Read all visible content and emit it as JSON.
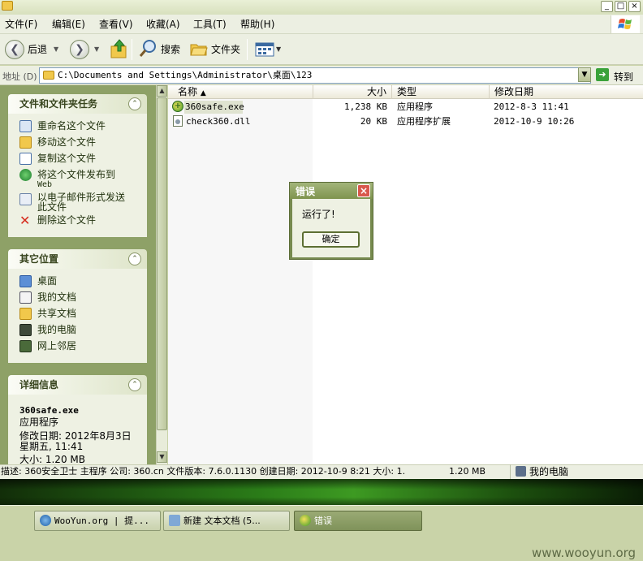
{
  "window": {
    "menu": [
      "文件(F)",
      "编辑(E)",
      "查看(V)",
      "收藏(A)",
      "工具(T)",
      "帮助(H)"
    ],
    "caption_buttons": [
      "_",
      "□",
      "×"
    ]
  },
  "toolbar": {
    "back_label": "后退",
    "search_label": "搜索",
    "folders_label": "文件夹"
  },
  "address": {
    "label": "地址 (D)",
    "value": "C:\\Documents and Settings\\Administrator\\桌面\\123",
    "go_label": "转到"
  },
  "tasks": {
    "file_tasks": {
      "title": "文件和文件夹任务",
      "items": [
        {
          "label": "重命名这个文件",
          "icon": "rename-icon"
        },
        {
          "label": "移动这个文件",
          "icon": "move-icon"
        },
        {
          "label": "复制这个文件",
          "icon": "copy-icon"
        },
        {
          "label": "将这个文件发布到",
          "label2": "Web",
          "icon": "publish-web-icon"
        },
        {
          "label": "以电子邮件形式发送",
          "label2": "此文件",
          "icon": "email-icon"
        },
        {
          "label": "删除这个文件",
          "icon": "delete-icon"
        }
      ]
    },
    "other_places": {
      "title": "其它位置",
      "items": [
        {
          "label": "桌面",
          "icon": "desktop-icon"
        },
        {
          "label": "我的文档",
          "icon": "my-documents-icon"
        },
        {
          "label": "共享文档",
          "icon": "shared-documents-icon"
        },
        {
          "label": "我的电脑",
          "icon": "my-computer-icon"
        },
        {
          "label": "网上邻居",
          "icon": "network-places-icon"
        }
      ]
    },
    "details": {
      "title": "详细信息",
      "filename": "360safe.exe",
      "type": "应用程序",
      "modified_line1": "修改日期: 2012年8月3日",
      "modified_line2": "星期五, 11:41",
      "size": "大小: 1.20 MB"
    }
  },
  "filelist": {
    "columns": {
      "name": "名称",
      "size": "大小",
      "type": "类型",
      "modified": "修改日期"
    },
    "rows": [
      {
        "name": "360safe.exe",
        "size": "1,238 KB",
        "type": "应用程序",
        "modified": "2012-8-3  11:41"
      },
      {
        "name": "check360.dll",
        "size": "20 KB",
        "type": "应用程序扩展",
        "modified": "2012-10-9  10:26"
      }
    ]
  },
  "dialog": {
    "title": "错误",
    "message": "运行了!",
    "ok_label": "确定",
    "close_label": "×"
  },
  "status": {
    "description": "描述: 360安全卫士 主程序 公司: 360.cn 文件版本: 7.6.0.1130 创建日期: 2012-10-9 8:21 大小: 1.",
    "size": "1.20 MB",
    "zone": "我的电脑"
  },
  "taskbar": {
    "items": [
      {
        "label": "WooYun.org | 提...",
        "icon": "ie-icon"
      },
      {
        "label": "新建 文本文档 (5...",
        "icon": "notepad-icon"
      },
      {
        "label": "错误",
        "icon": "app-360-icon"
      }
    ],
    "watermark": "www.wooyun.org"
  },
  "colors": {
    "accent": "#8ea167",
    "dialog_frame": "#768a4e",
    "taskbar": "#c9d3a8"
  }
}
